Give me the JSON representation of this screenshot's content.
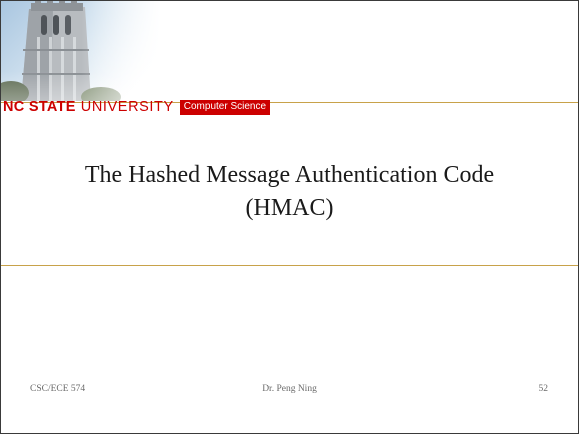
{
  "header": {
    "brand_state": "NC STATE",
    "brand_university": "UNIVERSITY",
    "department": "Computer Science"
  },
  "slide": {
    "title_line1": "The Hashed Message Authentication Code",
    "title_line2": "(HMAC)"
  },
  "footer": {
    "course": "CSC/ECE 574",
    "author": "Dr. Peng Ning",
    "page_number": "52"
  },
  "colors": {
    "brand_red": "#cc0000",
    "rule_gold": "#c8a24a",
    "sky_blue": "#cfe0ef"
  }
}
